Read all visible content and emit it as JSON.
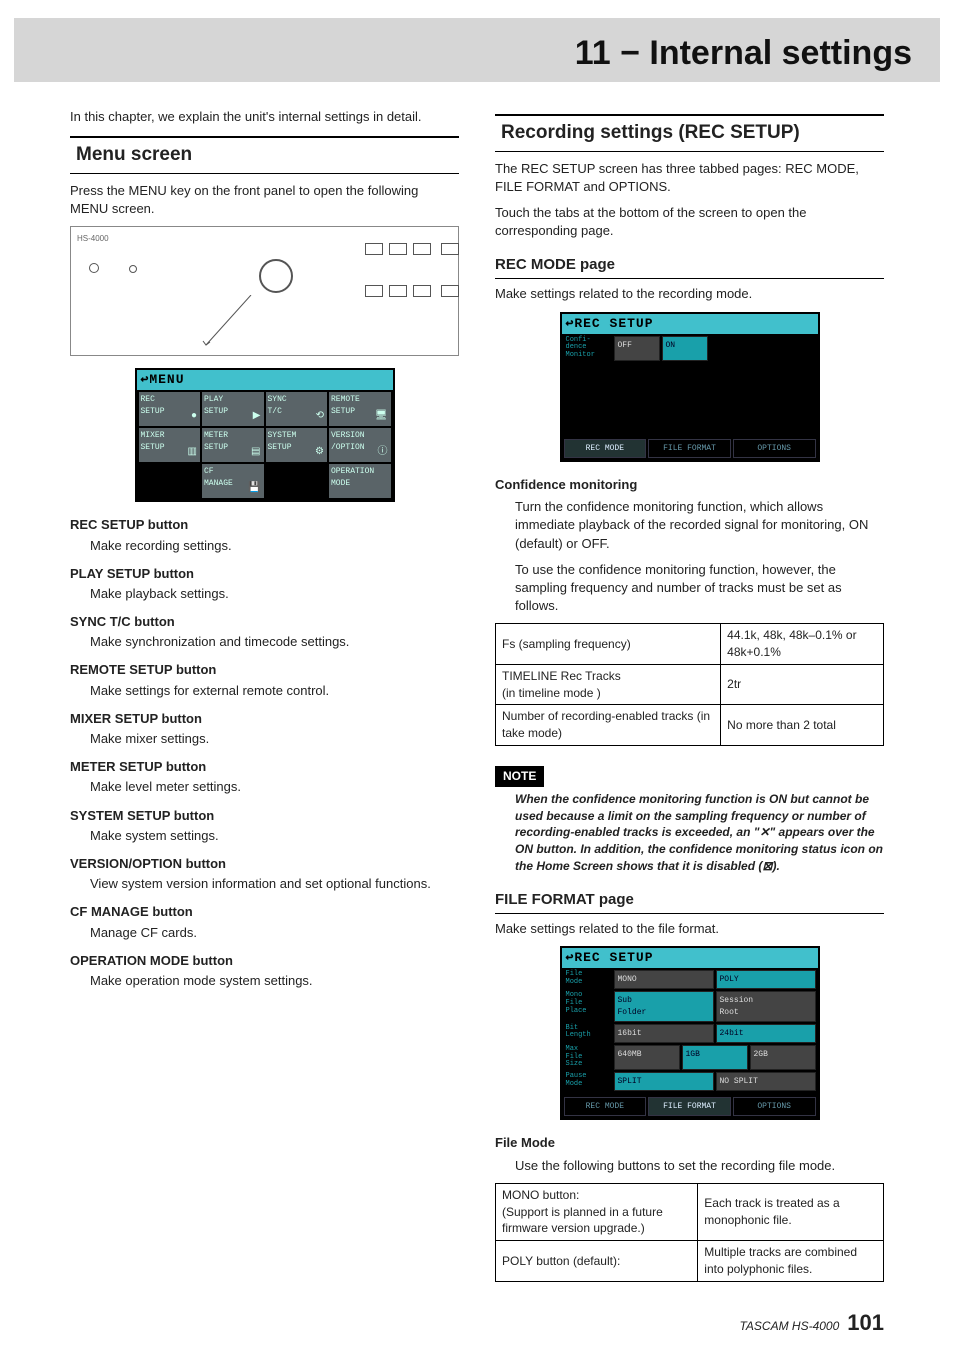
{
  "chapter_title": "11 − Internal settings",
  "left": {
    "intro": "In this chapter, we explain the unit's internal settings in detail.",
    "menu_heading": "Menu screen",
    "menu_intro": "Press the MENU key on the front panel to open the following MENU screen.",
    "menu_screen": {
      "title": "MENU",
      "cells": [
        {
          "l": "REC\\nSETUP",
          "i": "●"
        },
        {
          "l": "PLAY\\nSETUP",
          "i": "▶"
        },
        {
          "l": "SYNC\\nT/C",
          "i": "⟲"
        },
        {
          "l": "REMOTE\\nSETUP",
          "i": "🖥"
        },
        {
          "l": "MIXER\\nSETUP",
          "i": "▥"
        },
        {
          "l": "METER\\nSETUP",
          "i": "▤"
        },
        {
          "l": "SYSTEM\\nSETUP",
          "i": "⚙"
        },
        {
          "l": "VERSION\\n/OPTION",
          "i": "ⓘ"
        },
        {
          "l": "",
          "i": ""
        },
        {
          "l": "CF\\nMANAGE",
          "i": "💾"
        },
        {
          "l": "",
          "i": ""
        },
        {
          "l": "OPERATION\\nMODE",
          "i": ""
        }
      ]
    },
    "buttons": [
      {
        "t": "REC SETUP button",
        "d": "Make recording settings."
      },
      {
        "t": "PLAY SETUP button",
        "d": "Make playback settings."
      },
      {
        "t": "SYNC T/C button",
        "d": "Make synchronization and timecode settings."
      },
      {
        "t": "REMOTE SETUP button",
        "d": "Make settings for external remote control."
      },
      {
        "t": "MIXER SETUP button",
        "d": "Make mixer settings."
      },
      {
        "t": "METER SETUP button",
        "d": "Make level meter settings."
      },
      {
        "t": "SYSTEM SETUP button",
        "d": "Make system settings."
      },
      {
        "t": "VERSION/OPTION button",
        "d": "View system version information and set optional functions."
      },
      {
        "t": "CF MANAGE button",
        "d": "Manage CF cards."
      },
      {
        "t": "OPERATION MODE button",
        "d": "Make operation mode system settings."
      }
    ]
  },
  "right": {
    "rec_heading": "Recording settings (REC SETUP)",
    "rec_intro1": "The REC SETUP screen has three tabbed pages: REC MODE, FILE FORMAT and OPTIONS.",
    "rec_intro2": "Touch the tabs at the bottom of the screen to open the corresponding page.",
    "recmode_heading": "REC MODE page",
    "recmode_intro": "Make settings related to the recording mode.",
    "recmode_screen": {
      "title": "REC SETUP",
      "row_label": "Confi-\\ndence\\nMonitor",
      "off": "OFF",
      "on": "ON",
      "tabs": [
        "REC MODE",
        "FILE FORMAT",
        "OPTIONS"
      ]
    },
    "conf_title": "Confidence monitoring",
    "conf_p1": "Turn the confidence monitoring function, which allows immediate playback of the recorded signal for monitoring, ON (default) or OFF.",
    "conf_p2": "To use the confidence monitoring function, however, the sampling frequency and number of tracks must be set as follows.",
    "conf_table": [
      [
        "Fs (sampling frequency)",
        "44.1k, 48k, 48k–0.1% or 48k+0.1%"
      ],
      [
        "TIMELINE Rec Tracks\\n(in timeline mode )",
        "2tr"
      ],
      [
        "Number of recording-enabled tracks (in take mode)",
        "No more than 2 total"
      ]
    ],
    "note_label": "NOTE",
    "note_body": "When the confidence monitoring function is ON but cannot be used because a limit on the sampling frequency or number of recording-enabled tracks is exceeded, an \"✕\" appears over the ON button. In addition, the confidence monitoring status icon on the Home Screen shows that it is disabled (⊠).",
    "ff_heading": "FILE FORMAT page",
    "ff_intro": "Make settings related to the file format.",
    "ff_screen": {
      "title": "REC SETUP",
      "rows": [
        {
          "lab": "File\\nMode",
          "opts": [
            "MONO",
            "POLY"
          ],
          "sel": 1
        },
        {
          "lab": "Mono\\nFile\\nPlace",
          "opts": [
            "Sub\\nFolder",
            "Session\\nRoot"
          ],
          "sel": 0
        },
        {
          "lab": "Bit\\nLength",
          "opts": [
            "16bit",
            "24bit"
          ],
          "sel": 1
        },
        {
          "lab": "Max\\nFile\\nSize",
          "opts": [
            "640MB",
            "1GB",
            "2GB"
          ],
          "sel": 1
        },
        {
          "lab": "Pause\\nMode",
          "opts": [
            "SPLIT",
            "NO SPLIT"
          ],
          "sel": 0
        }
      ],
      "tabs": [
        "REC MODE",
        "FILE FORMAT",
        "OPTIONS"
      ]
    },
    "fm_title": "File Mode",
    "fm_intro": "Use the following buttons to set the recording file mode.",
    "fm_table": [
      [
        "MONO button:\\n(Support is planned in a future firmware version upgrade.)",
        "Each track is treated as a monophonic file."
      ],
      [
        "POLY button (default):",
        "Multiple tracks are combined into polyphonic files."
      ]
    ]
  },
  "footer": {
    "model": "TASCAM HS-4000",
    "page": "101"
  }
}
